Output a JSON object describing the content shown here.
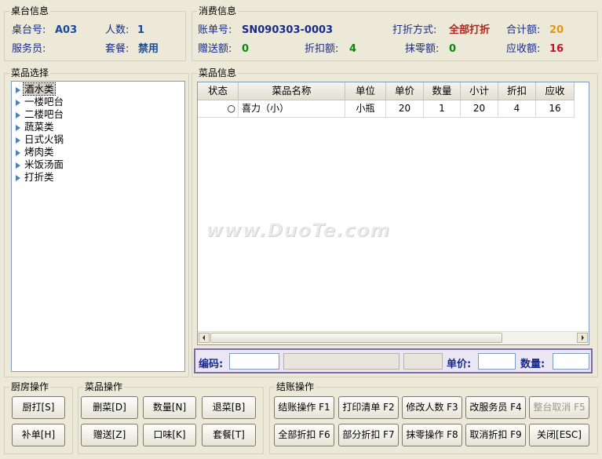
{
  "table_info": {
    "title": "桌台信息",
    "table_no_label": "桌台号:",
    "table_no": "A03",
    "people_label": "人数:",
    "people": "1",
    "waiter_label": "服务员:",
    "waiter": "",
    "set_meal_label": "套餐:",
    "set_meal": "禁用"
  },
  "consumption_info": {
    "title": "消费信息",
    "bill_no_label": "账单号:",
    "bill_no": "SN090303-0003",
    "discount_mode_label": "打折方式:",
    "discount_mode": "全部打折",
    "total_label": "合计额:",
    "total": "20",
    "gift_label": "赠送额:",
    "gift": "0",
    "discount_amount_label": "折扣额:",
    "discount_amount": "4",
    "rounding_label": "抹零额:",
    "rounding": "0",
    "receivable_label": "应收额:",
    "receivable": "16"
  },
  "dish_select": {
    "title": "菜品选择",
    "categories": [
      "酒水类",
      "一楼吧台",
      "二楼吧台",
      "蔬菜类",
      "日式火锅",
      "烤肉类",
      "米饭汤面",
      "打折类"
    ],
    "selected": "酒水类"
  },
  "dish_info": {
    "title": "菜品信息",
    "columns": [
      "状态",
      "菜品名称",
      "单位",
      "单价",
      "数量",
      "小计",
      "折扣",
      "应收"
    ],
    "rows": [
      {
        "status": "○",
        "name": "喜力（小）",
        "unit": "小瓶",
        "price": "20",
        "qty": "1",
        "subtotal": "20",
        "discount": "4",
        "receivable": "16"
      }
    ]
  },
  "input_bar": {
    "code_label": "编码:",
    "price_label": "单价:",
    "qty_label": "数量:"
  },
  "kitchen_ops": {
    "title": "厨房操作",
    "buttons": [
      "厨打[S]",
      "补单[H]"
    ]
  },
  "dish_ops": {
    "title": "菜品操作",
    "buttons": [
      "删菜[D]",
      "数量[N]",
      "退菜[B]",
      "赠送[Z]",
      "口味[K]",
      "套餐[T]"
    ]
  },
  "checkout_ops": {
    "title": "结账操作",
    "buttons": [
      "结账操作 F1",
      "打印清单 F2",
      "修改人数 F3",
      "改服务员 F4",
      "整台取消 F5",
      "全部折扣 F6",
      "部分折扣 F7",
      "抹零操作 F8",
      "取消折扣 F9",
      "关闭[ESC]"
    ]
  },
  "watermark": "www.DuoTe.com",
  "colors": {
    "background": "#ece9d8",
    "label": "#1a2b8a",
    "accent_purple": "#7e6aa8",
    "receivable_red": "#c8102e"
  }
}
